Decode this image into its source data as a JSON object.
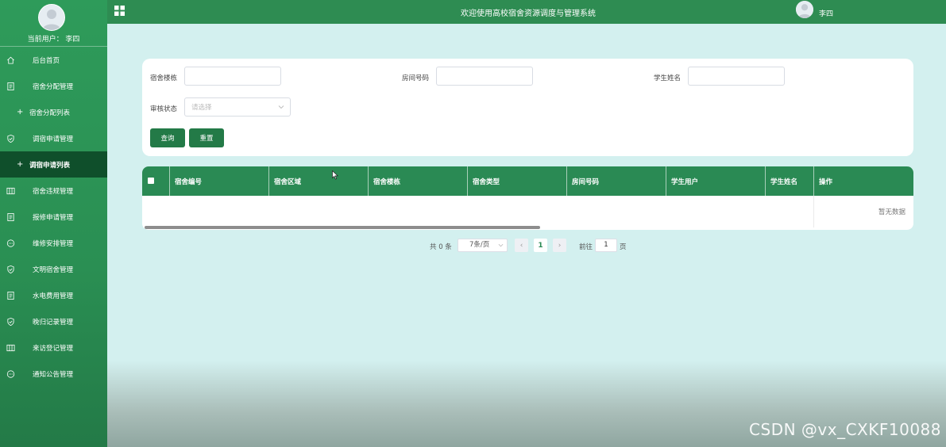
{
  "sidebar": {
    "current_user_label": "当前用户： 李四",
    "menu": [
      {
        "label": "后台首页",
        "icon": "home-icon"
      },
      {
        "label": "宿舍分配管理",
        "icon": "document-icon"
      },
      {
        "label": "宿舍分配列表",
        "icon": "plus-icon",
        "sub": true
      },
      {
        "label": "调宿申请管理",
        "icon": "shield-check-icon"
      },
      {
        "label": "调宿申请列表",
        "icon": "plus-icon",
        "sub": true,
        "active": true
      },
      {
        "label": "宿舍违规管理",
        "icon": "columns-icon"
      },
      {
        "label": "报修申请管理",
        "icon": "document-icon"
      },
      {
        "label": "维修安排管理",
        "icon": "chat-icon"
      },
      {
        "label": "文明宿舍管理",
        "icon": "shield-check-icon"
      },
      {
        "label": "水电费用管理",
        "icon": "document-icon"
      },
      {
        "label": "晚归记录管理",
        "icon": "shield-check-icon"
      },
      {
        "label": "来访登记管理",
        "icon": "columns-icon"
      },
      {
        "label": "通知公告管理",
        "icon": "chat-icon"
      }
    ]
  },
  "header": {
    "title": "欢迎使用高校宿舍资源调度与管理系统",
    "username": "李四"
  },
  "search": {
    "building_label": "宿舍楼栋",
    "building_value": "",
    "room_label": "房间号码",
    "room_value": "",
    "student_label": "学生姓名",
    "student_value": "",
    "status_label": "审核状态",
    "status_placeholder": "请选择",
    "query_button": "查询",
    "reset_button": "重置"
  },
  "table": {
    "columns": [
      "宿舍编号",
      "宿舍区域",
      "宿舍楼栋",
      "宿舍类型",
      "房间号码",
      "学生用户",
      "学生姓名",
      "操作"
    ],
    "empty_text": "暂无数据"
  },
  "pagination": {
    "total_text": "共 0 条",
    "page_size": "7条/页",
    "current_page": "1",
    "goto_label": "前往",
    "goto_value": "1",
    "page_suffix": "页"
  },
  "watermark": "CSDN @vx_CXKF10088",
  "colors": {
    "primary": "#2e8c52",
    "active_menu": "#0f4f2b",
    "background": "#d3f0ef"
  }
}
